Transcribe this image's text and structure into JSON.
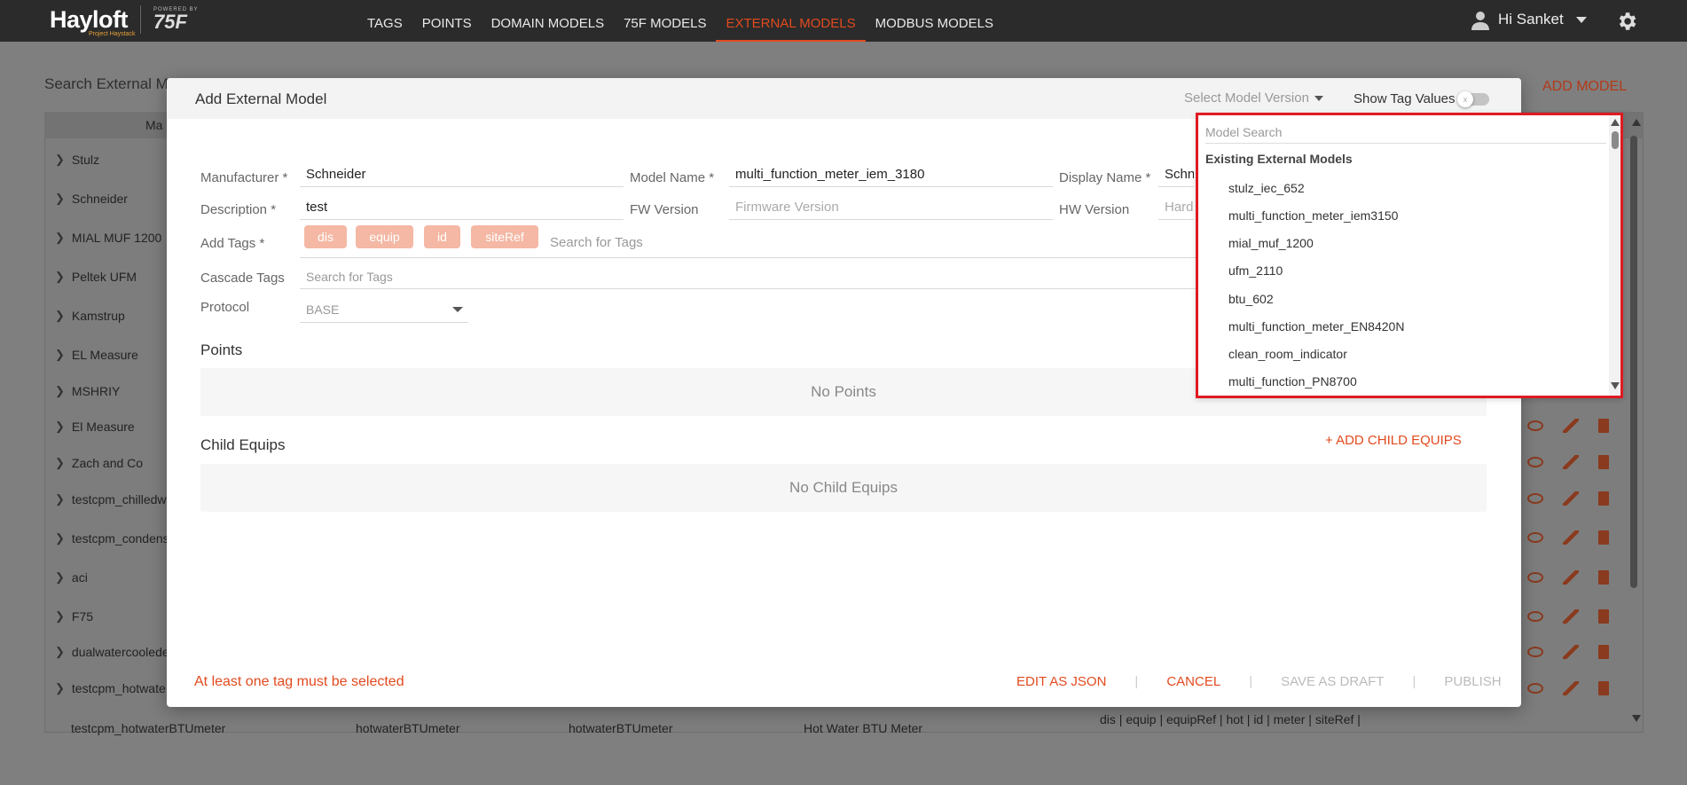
{
  "app": {
    "logo": "Hayloft",
    "logo_sub": "Project Haystack",
    "powered_by": "POWERED BY",
    "brand": "75F"
  },
  "nav": {
    "items": [
      "TAGS",
      "POINTS",
      "DOMAIN MODELS",
      "75F MODELS",
      "EXTERNAL MODELS",
      "MODBUS MODELS"
    ],
    "active": "EXTERNAL MODELS"
  },
  "user": {
    "greeting": "Hi Sanket"
  },
  "background": {
    "title": "Search External M",
    "add_model": "ADD MODEL",
    "header_col": "Ma",
    "rows": [
      "Stulz",
      "Schneider",
      "MIAL MUF 1200",
      "Peltek UFM",
      "Kamstrup",
      "EL Measure",
      "MSHRIY",
      "El Measure",
      "Zach and Co",
      "testcpm_chilledw",
      "testcpm_condens",
      "aci",
      "F75",
      "dualwatercoolede",
      "testcpm_hotwate"
    ],
    "bottom_row": {
      "name": "testcpm_hotwaterBTUmeter",
      "col2": "hotwaterBTUmeter",
      "col3": "hotwaterBTUmeter",
      "col4": "Hot Water BTU Meter",
      "tags": "dis | equip | equipRef | hot | id | meter | siteRef |"
    }
  },
  "modal": {
    "title": "Add External Model",
    "version_placeholder": "Select Model Version",
    "show_tag_values": "Show Tag Values",
    "toggle_off": "x",
    "fields": {
      "manufacturer_label": "Manufacturer *",
      "manufacturer_value": "Schneider",
      "model_name_label": "Model Name *",
      "model_name_value": "multi_function_meter_iem_3180",
      "display_name_label": "Display Name *",
      "display_name_value": "Schn",
      "description_label": "Description *",
      "description_value": "test",
      "fw_label": "FW Version",
      "fw_placeholder": "Firmware Version",
      "hw_label": "HW Version",
      "hw_placeholder": "Hard",
      "add_tags_label": "Add Tags *",
      "tags": [
        "dis",
        "equip",
        "id",
        "siteRef"
      ],
      "tags_placeholder": "Search for Tags",
      "cascade_label": "Cascade Tags",
      "cascade_placeholder": "Search for Tags",
      "protocol_label": "Protocol",
      "protocol_value": "BASE"
    },
    "points_title": "Points",
    "no_points": "No Points",
    "child_equips_title": "Child Equips",
    "add_child_equips": "+ ADD CHILD EQUIPS",
    "no_child_equips": "No Child Equips",
    "error": "At least one tag must be selected",
    "actions": {
      "edit_json": "EDIT AS JSON",
      "cancel": "CANCEL",
      "save_draft": "SAVE AS DRAFT",
      "publish": "PUBLISH",
      "separator": "|"
    }
  },
  "dropdown": {
    "search_placeholder": "Model Search",
    "group": "Existing External Models",
    "items": [
      "stulz_iec_652",
      "multi_function_meter_iem3150",
      "mial_muf_1200",
      "ufm_2110",
      "btu_602",
      "multi_function_meter_EN8420N",
      "clean_room_indicator",
      "multi_function_PN8700"
    ]
  },
  "colors": {
    "accent": "#e24a1e",
    "topbar": "#2b2b2b",
    "chip": "#f4b8a4",
    "highlight": "#e01a22"
  }
}
